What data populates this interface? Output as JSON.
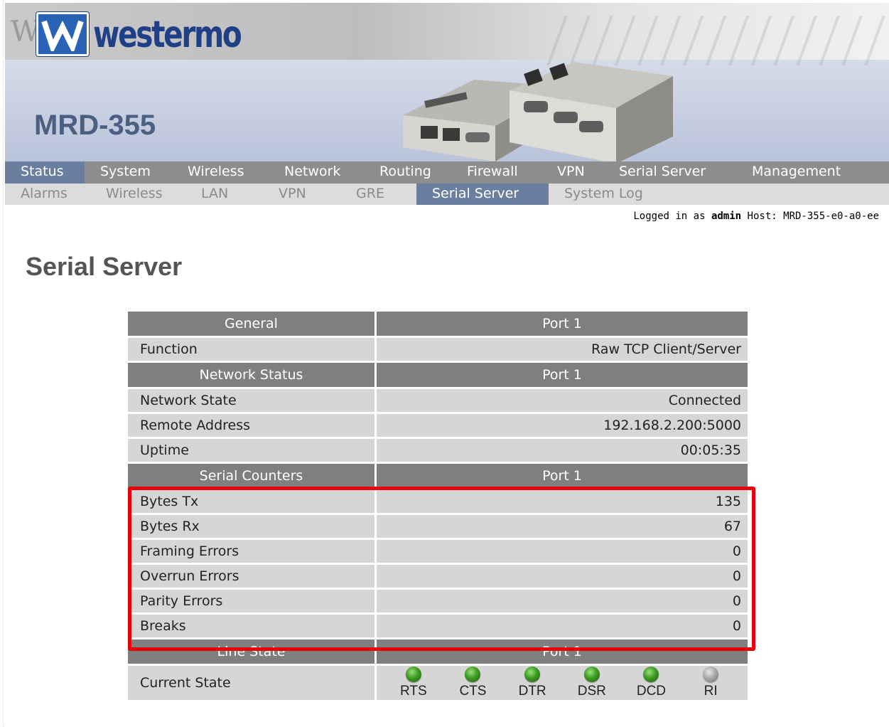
{
  "brand": {
    "logo_text": "westermo",
    "model": "MRD-355"
  },
  "nav": {
    "main": [
      "Status",
      "System",
      "Wireless",
      "Network",
      "Routing",
      "Firewall",
      "VPN",
      "Serial Server",
      "Management"
    ],
    "active_main": "Status",
    "sub": [
      "Alarms",
      "Wireless",
      "LAN",
      "VPN",
      "GRE",
      "Serial Server",
      "System Log"
    ],
    "active_sub": "Serial Server"
  },
  "login": {
    "prefix": "Logged in as",
    "user": "admin",
    "host_label": "Host:",
    "host": "MRD-355-e0-a0-ee"
  },
  "page": {
    "title": "Serial Server"
  },
  "table": {
    "general": {
      "header": "General",
      "port": "Port 1",
      "rows": [
        {
          "label": "Function",
          "value": "Raw TCP Client/Server"
        }
      ]
    },
    "network_status": {
      "header": "Network Status",
      "port": "Port 1",
      "rows": [
        {
          "label": "Network State",
          "value": "Connected"
        },
        {
          "label": "Remote Address",
          "value": "192.168.2.200:5000"
        },
        {
          "label": "Uptime",
          "value": "00:05:35"
        }
      ]
    },
    "serial_counters": {
      "header": "Serial Counters",
      "port": "Port 1",
      "rows": [
        {
          "label": "Bytes Tx",
          "value": "135"
        },
        {
          "label": "Bytes Rx",
          "value": "67"
        },
        {
          "label": "Framing Errors",
          "value": "0"
        },
        {
          "label": "Overrun Errors",
          "value": "0"
        },
        {
          "label": "Parity Errors",
          "value": "0"
        },
        {
          "label": "Breaks",
          "value": "0"
        }
      ]
    },
    "line_state": {
      "header": "Line State",
      "port": "Port 1",
      "current_state_label": "Current State",
      "signals": [
        {
          "name": "RTS",
          "state": "on"
        },
        {
          "name": "CTS",
          "state": "on"
        },
        {
          "name": "DTR",
          "state": "on"
        },
        {
          "name": "DSR",
          "state": "on"
        },
        {
          "name": "DCD",
          "state": "on"
        },
        {
          "name": "RI",
          "state": "off"
        }
      ]
    }
  },
  "colors": {
    "highlight": "#e8000a",
    "nav_active": "#6a7fa0",
    "header_gray": "#7f7f7f",
    "cell_gray": "#d6d6d6",
    "led_on": "#3c9a22",
    "led_off": "#a4a4a4"
  }
}
